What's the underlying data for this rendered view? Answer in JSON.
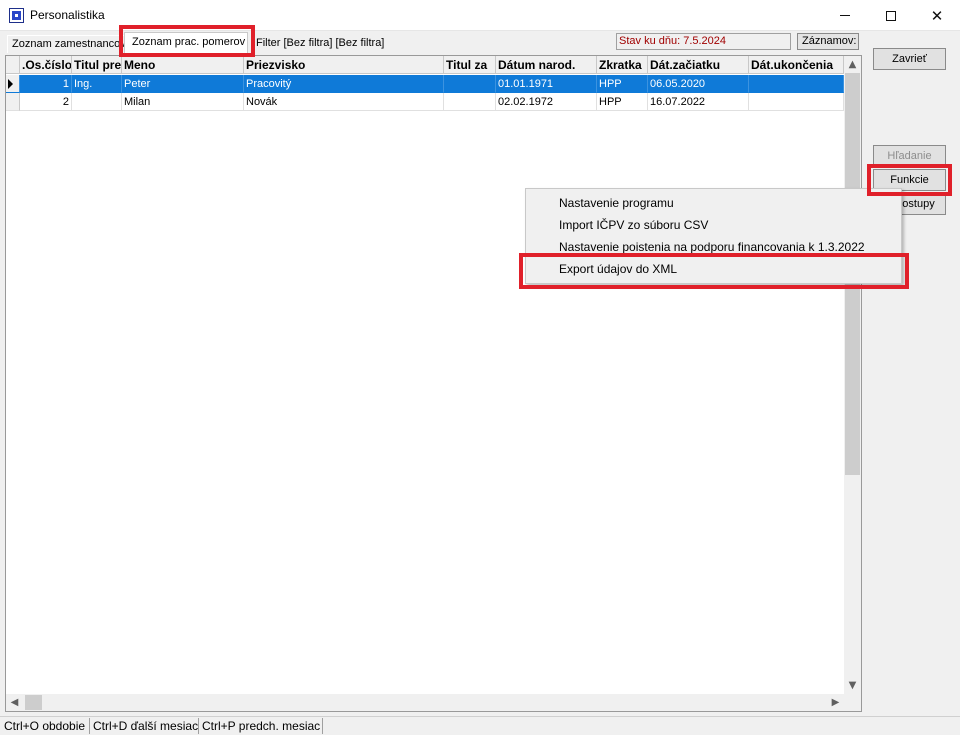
{
  "window": {
    "title": "Personalistika",
    "close_glyph": "✕"
  },
  "tabs": [
    {
      "label": "Zoznam zamestnancov"
    },
    {
      "label": "Zoznam prac. pomerov"
    }
  ],
  "filter": {
    "text": "Filter [Bez filtra] [Bez filtra]"
  },
  "stav": {
    "text": "Stav ku dňu: 7.5.2024"
  },
  "zaznamov_button": "Záznamov:",
  "table": {
    "columns": [
      ".Os.číslo",
      "Titul pre",
      "Meno",
      "Priezvisko",
      "Titul za",
      "Dátum narod.",
      "Zkratka",
      "Dát.začiatku",
      "Dát.ukončenia"
    ],
    "rows": [
      {
        "os_cislo": "1",
        "titul_pred": "Ing.",
        "meno": "Peter",
        "priezvisko": "Pracovitý",
        "titul_za": "",
        "datum_narod": "01.01.1971",
        "zkratka": "HPP",
        "dat_zaciatku": "06.05.2020",
        "dat_ukoncenia": ""
      },
      {
        "os_cislo": "2",
        "titul_pred": "",
        "meno": "Milan",
        "priezvisko": "Novák",
        "titul_za": "",
        "datum_narod": "02.02.1972",
        "zkratka": "HPP",
        "dat_zaciatku": "16.07.2022",
        "dat_ukoncenia": ""
      }
    ]
  },
  "buttons": {
    "zavriet": "Zavrieť",
    "hladanie": "Hľadanie",
    "funkcie": "Funkcie",
    "postupy": "ostupy"
  },
  "menu": {
    "items": [
      "Nastavenie programu",
      "Import IČPV zo súboru CSV",
      "Nastavenie poistenia na podporu financovania k 1.3.2022",
      "Export údajov do XML"
    ]
  },
  "statusbar": {
    "items": [
      "Ctrl+O obdobie",
      "Ctrl+D ďalší mesiac",
      "Ctrl+P predch. mesiac"
    ]
  },
  "colors": {
    "selection": "#0f7ad8",
    "highlight": "#e0202a",
    "stav_text": "#a00000"
  }
}
